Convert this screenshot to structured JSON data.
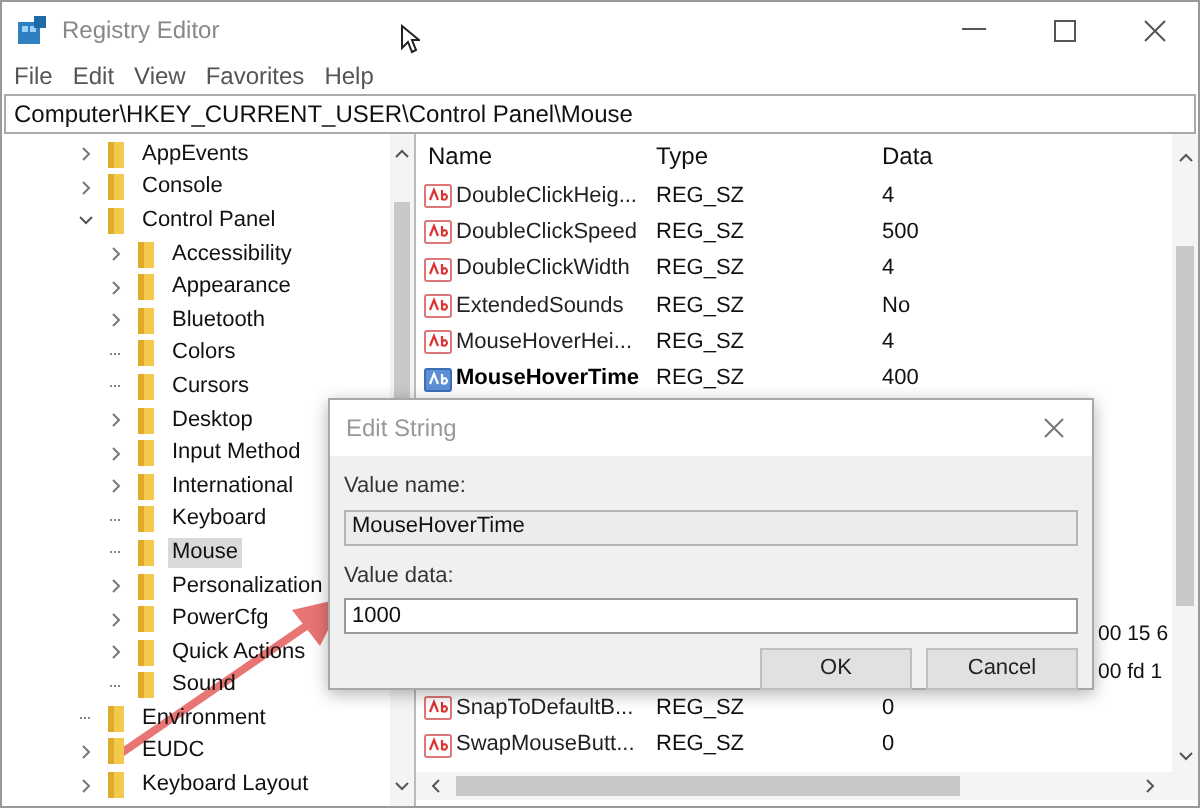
{
  "window": {
    "title": "Registry Editor"
  },
  "menu": [
    "File",
    "Edit",
    "View",
    "Favorites",
    "Help"
  ],
  "address": "Computer\\HKEY_CURRENT_USER\\Control Panel\\Mouse",
  "tree": [
    {
      "kind": "branch",
      "label": "AppEvents",
      "expanded": false,
      "selected": false
    },
    {
      "kind": "branch",
      "label": "Console",
      "expanded": false,
      "selected": false
    },
    {
      "kind": "branch",
      "label": "Control Panel",
      "expanded": true,
      "selected": false,
      "children": [
        {
          "kind": "branch",
          "label": "Accessibility",
          "expanded": false,
          "selected": false
        },
        {
          "kind": "branch",
          "label": "Appearance",
          "expanded": false,
          "selected": false
        },
        {
          "kind": "branch",
          "label": "Bluetooth",
          "expanded": false,
          "selected": false
        },
        {
          "kind": "leaf",
          "label": "Colors",
          "selected": false
        },
        {
          "kind": "leaf",
          "label": "Cursors",
          "selected": false
        },
        {
          "kind": "branch",
          "label": "Desktop",
          "expanded": false,
          "selected": false
        },
        {
          "kind": "branch",
          "label": "Input Method",
          "expanded": false,
          "selected": false
        },
        {
          "kind": "branch",
          "label": "International",
          "expanded": false,
          "selected": false
        },
        {
          "kind": "leaf",
          "label": "Keyboard",
          "selected": false
        },
        {
          "kind": "leaf",
          "label": "Mouse",
          "selected": true
        },
        {
          "kind": "branch",
          "label": "Personalization",
          "expanded": false,
          "selected": false
        },
        {
          "kind": "branch",
          "label": "PowerCfg",
          "expanded": false,
          "selected": false
        },
        {
          "kind": "branch",
          "label": "Quick Actions",
          "expanded": false,
          "selected": false
        },
        {
          "kind": "leaf",
          "label": "Sound",
          "selected": false
        }
      ]
    },
    {
      "kind": "leaf",
      "label": "Environment",
      "selected": false
    },
    {
      "kind": "branch",
      "label": "EUDC",
      "expanded": false,
      "selected": false
    },
    {
      "kind": "branch",
      "label": "Keyboard Layout",
      "expanded": false,
      "selected": false
    }
  ],
  "table": {
    "columns": [
      "Name",
      "Type",
      "Data"
    ],
    "rows": [
      {
        "kind": "value",
        "name": "DoubleClickHeig...",
        "type": "REG_SZ",
        "data": "4",
        "selected": false
      },
      {
        "kind": "value",
        "name": "DoubleClickSpeed",
        "type": "REG_SZ",
        "data": "500",
        "selected": false
      },
      {
        "kind": "value",
        "name": "DoubleClickWidth",
        "type": "REG_SZ",
        "data": "4",
        "selected": false
      },
      {
        "kind": "value",
        "name": "ExtendedSounds",
        "type": "REG_SZ",
        "data": "No",
        "selected": false
      },
      {
        "kind": "value",
        "name": "MouseHoverHei...",
        "type": "REG_SZ",
        "data": "4",
        "selected": false
      },
      {
        "kind": "value",
        "name": "MouseHoverTime",
        "type": "REG_SZ",
        "data": "400",
        "selected": true
      },
      {
        "kind": "covered"
      },
      {
        "kind": "covered"
      },
      {
        "kind": "covered"
      },
      {
        "kind": "covered"
      },
      {
        "kind": "covered"
      },
      {
        "kind": "covered"
      },
      {
        "kind": "covered",
        "data": "00 15 6"
      },
      {
        "kind": "covered",
        "data": "00 fd 1"
      },
      {
        "kind": "value",
        "name": "SnapToDefaultB...",
        "type": "REG_SZ",
        "data": "0",
        "selected": false
      },
      {
        "kind": "value",
        "name": "SwapMouseButt...",
        "type": "REG_SZ",
        "data": "0",
        "selected": false
      }
    ]
  },
  "dialog": {
    "title": "Edit String",
    "name_label": "Value name:",
    "name_value": "MouseHoverTime",
    "data_label": "Value data:",
    "data_value": "1000",
    "buttons": [
      "OK",
      "Cancel"
    ]
  }
}
